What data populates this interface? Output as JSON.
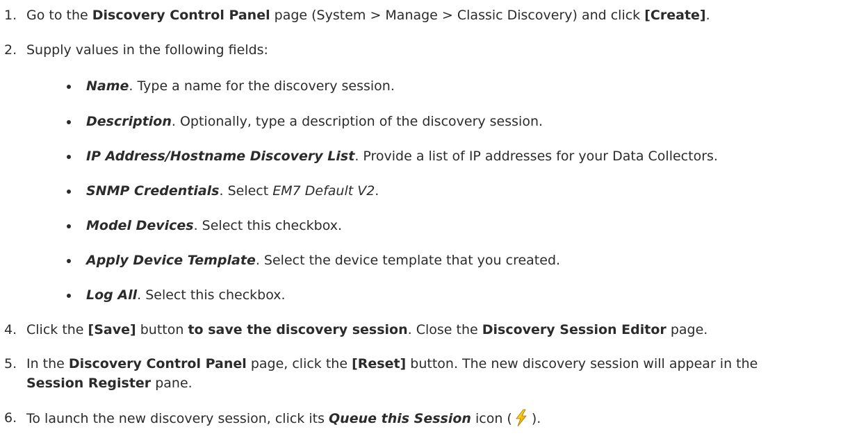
{
  "steps": {
    "s1": {
      "num": "1.",
      "a": "Go to the ",
      "b": "Discovery Control Panel",
      "c": " page (System > Manage > Classic Discovery) and click ",
      "d": "[Create]",
      "e": "."
    },
    "s2": {
      "num": "2.",
      "text": "Supply values in the following fields:"
    },
    "fields": [
      {
        "name": "Name",
        "desc": ". Type a name for the discovery session."
      },
      {
        "name": "Description",
        "desc": ". Optionally, type a description of the discovery session."
      },
      {
        "name": "IP Address/Hostname Discovery List",
        "desc": ". Provide a list of IP addresses for your Data Collectors."
      },
      {
        "name": "SNMP Credentials",
        "desc": ". Select ",
        "value": "EM7 Default V2",
        "end": "."
      },
      {
        "name": "Model Devices",
        "desc": ". Select this checkbox."
      },
      {
        "name": "Apply Device Template",
        "desc": ". Select the device template that you created."
      },
      {
        "name": "Log All",
        "desc": ". Select this checkbox."
      }
    ],
    "s4": {
      "num": "4.",
      "a": "Click the ",
      "b": "[Save]",
      "c": " button ",
      "d": "to save the discovery session",
      "e": ". Close the ",
      "f": "Discovery Session Editor",
      "g": " page."
    },
    "s5": {
      "num": "5.",
      "a": "In the ",
      "b": "Discovery Control Panel",
      "c": " page, click the ",
      "d": "[Reset]",
      "e": " button. The new discovery session will appear in the",
      "f": "Session Register",
      "g": " pane."
    },
    "s6": {
      "num": "6.",
      "a": "To launch the new discovery session, click its ",
      "b": "Queue this Session",
      "c": " icon (",
      "icon": "bolt-icon",
      "d": ")."
    }
  }
}
